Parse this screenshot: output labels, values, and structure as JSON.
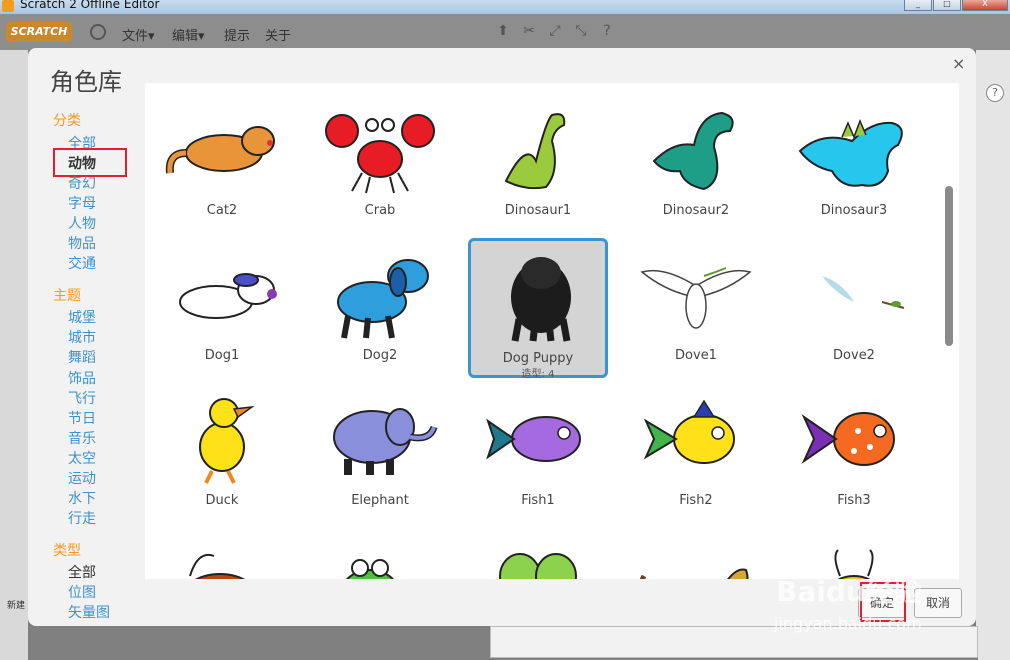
{
  "window": {
    "title": "Scratch 2 Offline Editor",
    "minimize": "_",
    "maximize": "□",
    "close": "X"
  },
  "menubar": {
    "logo": "SCRATCH",
    "items": [
      "文件▾",
      "编辑▾",
      "提示",
      "关于"
    ]
  },
  "dialog": {
    "title": "角色库",
    "close": "×",
    "category_heading": "分类",
    "categories": [
      "全部",
      "动物",
      "奇幻",
      "字母",
      "人物",
      "物品",
      "交通"
    ],
    "theme_heading": "主题",
    "themes": [
      "城堡",
      "城市",
      "舞蹈",
      "饰品",
      "飞行",
      "节日",
      "音乐",
      "太空",
      "运动",
      "水下",
      "行走"
    ],
    "type_heading": "类型",
    "types": [
      "全部",
      "位图",
      "矢量图"
    ],
    "selected_category": "动物"
  },
  "sprites": [
    {
      "name": "Cat2"
    },
    {
      "name": "Crab"
    },
    {
      "name": "Dinosaur1"
    },
    {
      "name": "Dinosaur2"
    },
    {
      "name": "Dinosaur3"
    },
    {
      "name": "Dog1"
    },
    {
      "name": "Dog2"
    },
    {
      "name": "Dog Puppy",
      "costume": "造型: 4"
    },
    {
      "name": "Dove1"
    },
    {
      "name": "Dove2"
    },
    {
      "name": "Duck"
    },
    {
      "name": "Elephant"
    },
    {
      "name": "Fish1"
    },
    {
      "name": "Fish2"
    },
    {
      "name": "Fish3"
    },
    {
      "name": ""
    },
    {
      "name": ""
    },
    {
      "name": ""
    },
    {
      "name": ""
    },
    {
      "name": ""
    }
  ],
  "buttons": {
    "ok": "确定",
    "cancel": "取消"
  },
  "left_panel": {
    "new_label": "新建"
  },
  "watermark": {
    "logo": "Baidu经验",
    "url": "jingyan.baidu.com"
  }
}
